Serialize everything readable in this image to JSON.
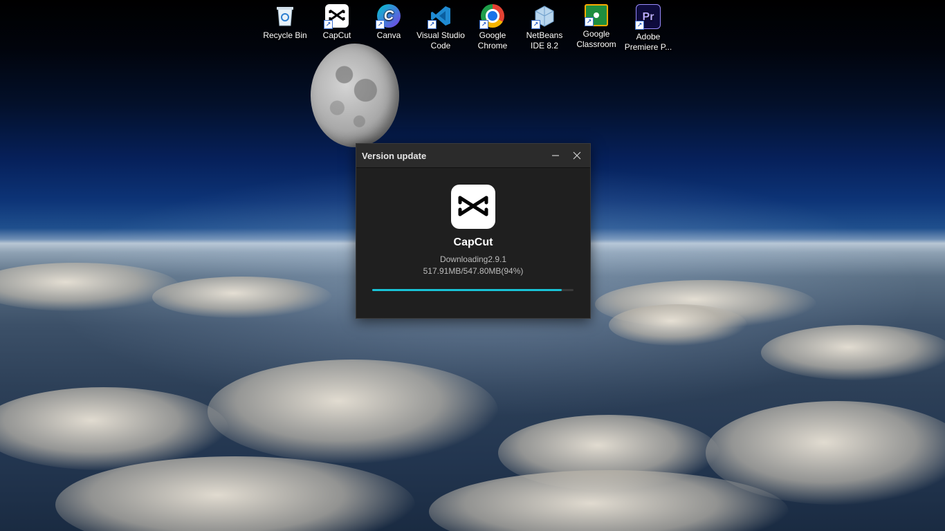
{
  "desktop": {
    "icons": [
      {
        "label": "Recycle Bin",
        "icon": "recycle-bin-icon",
        "color": "#d6e6f2"
      },
      {
        "label": "CapCut",
        "icon": "capcut-icon",
        "color": "#ffffff"
      },
      {
        "label": "Canva",
        "icon": "canva-icon",
        "color": "#7b3fe4"
      },
      {
        "label": "Visual Studio Code",
        "icon": "vscode-icon",
        "color": "#1f8ad2"
      },
      {
        "label": "Google Chrome",
        "icon": "chrome-icon",
        "color": "#e34133"
      },
      {
        "label": "NetBeans IDE 8.2",
        "icon": "netbeans-icon",
        "color": "#9cc6e8"
      },
      {
        "label": "Google Classroom",
        "icon": "google-classroom-icon",
        "color": "#1e8e3e"
      },
      {
        "label": "Adobe Premiere P...",
        "icon": "premiere-pro-icon",
        "color": "#0e0b3d"
      }
    ]
  },
  "dialog": {
    "title": "Version update",
    "minimize_icon": "minimize-icon",
    "close_icon": "close-icon",
    "app_name": "CapCut",
    "status": "Downloading2.9.1",
    "progress_text": "517.91MB/547.80MB(94%)",
    "progress_fraction": 0.94,
    "accent_color": "#19c3d6"
  }
}
